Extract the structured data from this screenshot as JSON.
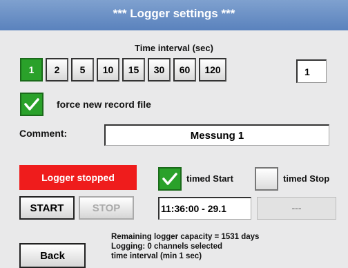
{
  "title": "***   Logger settings   ***",
  "interval": {
    "label": "Time interval (sec)",
    "options": [
      "1",
      "2",
      "5",
      "10",
      "15",
      "30",
      "60",
      "120"
    ],
    "selected": "1",
    "custom_value": "1"
  },
  "force_new": {
    "label": "force new record file",
    "checked": true
  },
  "comment": {
    "label": "Comment:",
    "value": "Messung 1"
  },
  "status": {
    "text": "Logger stopped",
    "color": "#ef1c1c"
  },
  "buttons": {
    "start": "START",
    "stop": "STOP",
    "back": "Back"
  },
  "timed_start": {
    "label": "timed Start",
    "checked": true,
    "value": "11:36:00 - 29.1"
  },
  "timed_stop": {
    "label": "timed Stop",
    "checked": false,
    "value": "---"
  },
  "info": {
    "line1": "Remaining logger capacity = 1531 days",
    "line2": "Logging: 0 channels selected",
    "line3": "time interval (min 1 sec)"
  },
  "colors": {
    "accent_green": "#2aa12a",
    "title_bar": "#6a8fc6"
  }
}
